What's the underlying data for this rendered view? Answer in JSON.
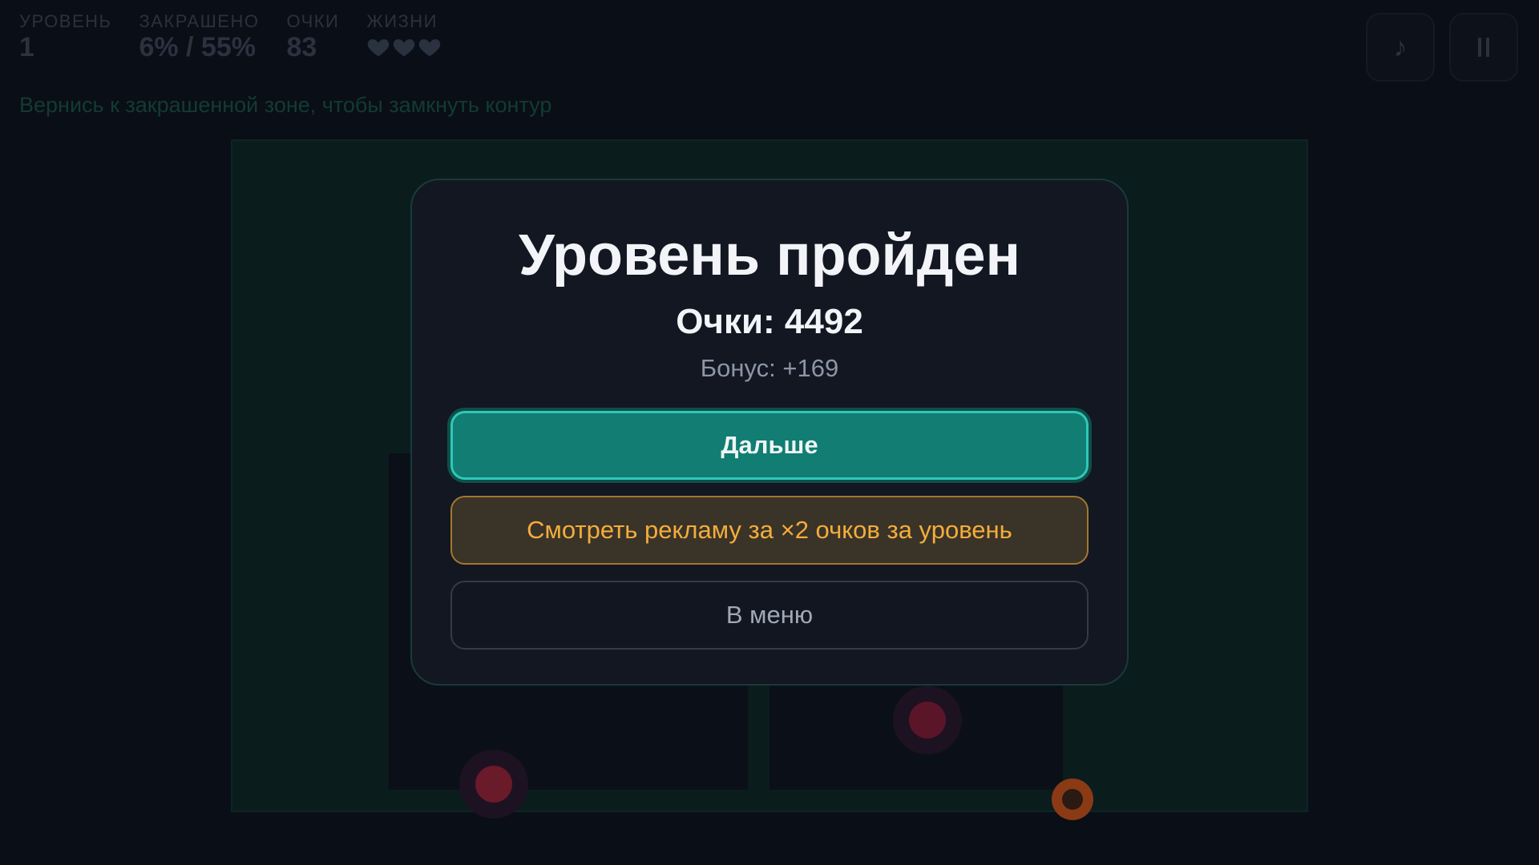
{
  "hud": {
    "level_label": "УРОВЕНЬ",
    "level_value": "1",
    "filled_label": "ЗАКРАШЕНО",
    "filled_value": "6% / 55%",
    "score_label": "ОЧКИ",
    "score_value": "83",
    "lives_label": "ЖИЗНИ",
    "lives": 3
  },
  "buttons": {
    "music_icon": "music-note-icon",
    "music_glyph": "♪",
    "pause_icon": "pause-icon",
    "pause_glyph": "⏸"
  },
  "hint": "Вернись к закрашенной зоне, чтобы замкнуть контур",
  "modal": {
    "title": "Уровень пройден",
    "score": "Очки: 4492",
    "bonus": "Бонус: +169",
    "next_label": "Дальше",
    "ad_label": "Смотреть рекламу за ×2 очков за уровень",
    "menu_label": "В меню"
  },
  "colors": {
    "accent": "#117d73",
    "accent_border": "#2fc8b7",
    "ad_text": "#f3ad3c",
    "field": "#0b1c1d",
    "enemy": "#6b1a2a",
    "enemy_orange": "#8a3a14"
  }
}
